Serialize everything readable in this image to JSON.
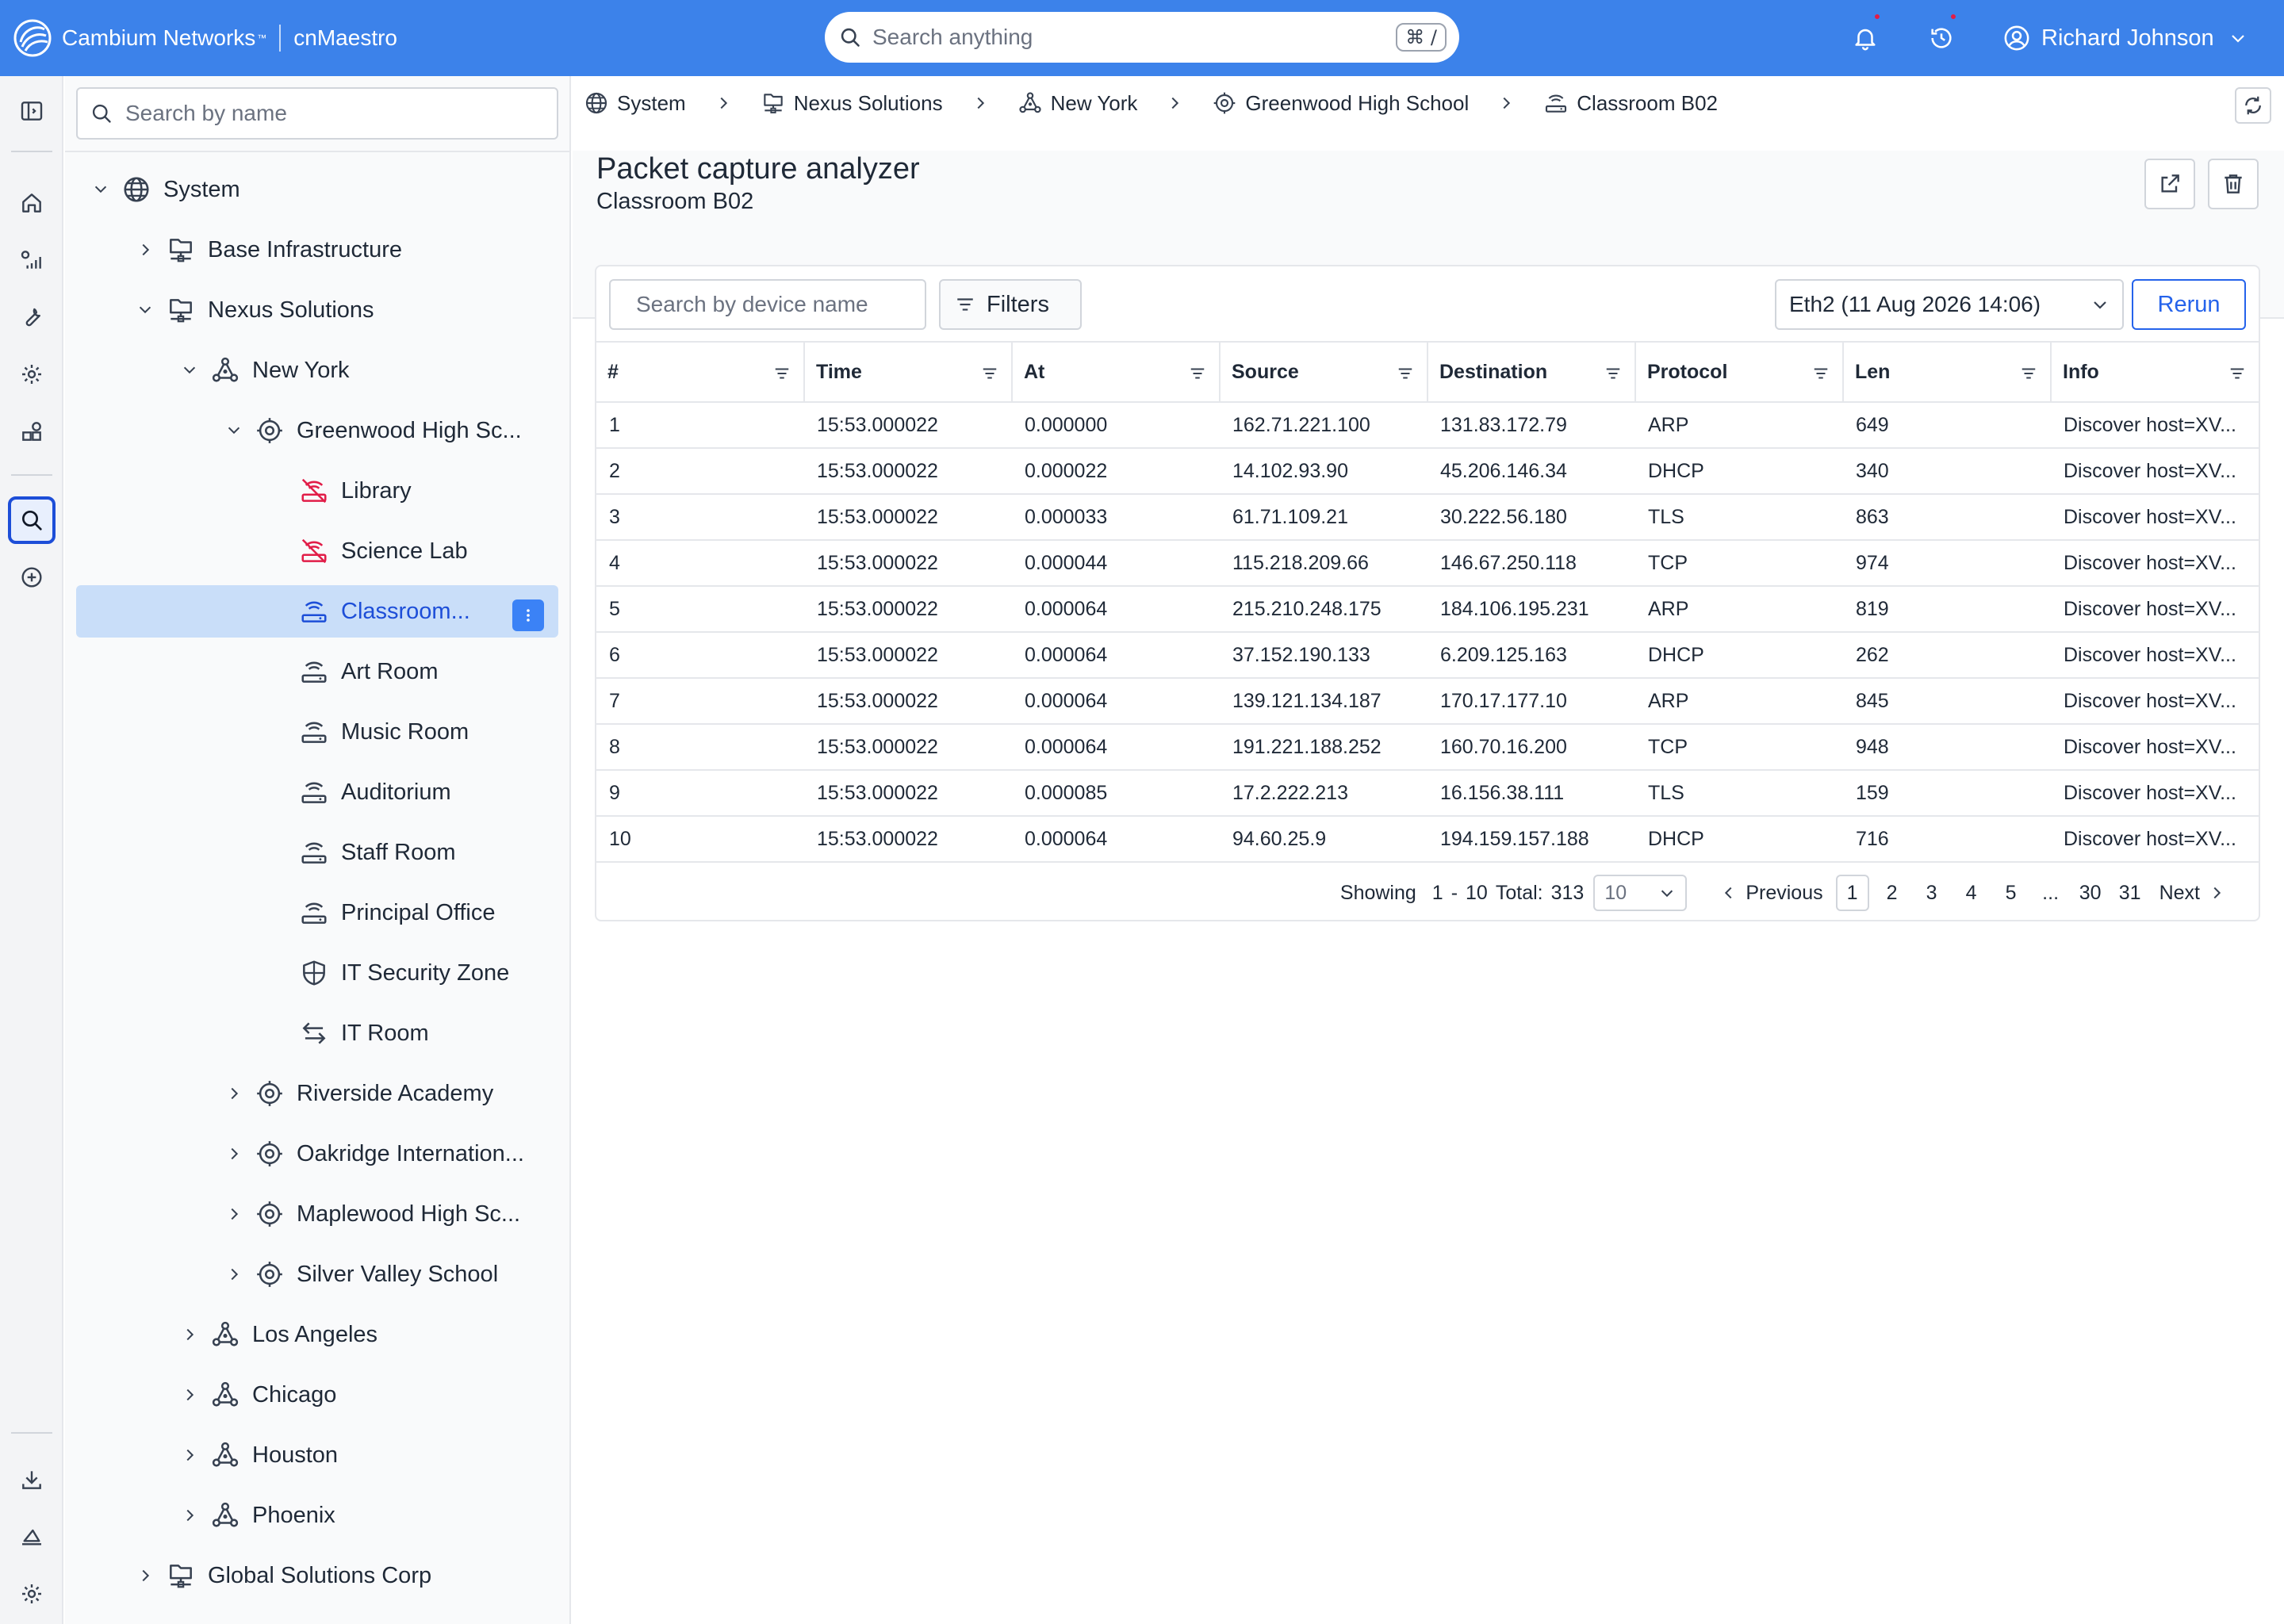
{
  "topbar": {
    "brand": "Cambium Networks",
    "brand_tm": "™",
    "product": "cnMaestro",
    "search_placeholder": "Search anything",
    "search_shortcut": "⌘ /",
    "user_name": "Richard Johnson"
  },
  "tree": {
    "search_placeholder": "Search by name",
    "nodes": [
      {
        "label": "System",
        "icon": "globe-icon",
        "expanded": true
      },
      {
        "label": "Base Infrastructure",
        "icon": "network-folder-icon",
        "expanded": false
      },
      {
        "label": "Nexus Solutions",
        "icon": "network-folder-icon",
        "expanded": true
      },
      {
        "label": "New York",
        "icon": "tower-icon",
        "expanded": true
      },
      {
        "label": "Greenwood High Sc...",
        "icon": "site-icon",
        "expanded": true
      },
      {
        "label": "Library",
        "icon": "ap-offline-icon"
      },
      {
        "label": "Science Lab",
        "icon": "ap-offline-icon"
      },
      {
        "label": "Classroom...",
        "icon": "ap-icon",
        "selected": true
      },
      {
        "label": "Art Room",
        "icon": "ap-icon"
      },
      {
        "label": "Music Room",
        "icon": "ap-icon"
      },
      {
        "label": "Auditorium",
        "icon": "ap-icon"
      },
      {
        "label": "Staff Room",
        "icon": "ap-icon"
      },
      {
        "label": "Principal Office",
        "icon": "ap-icon"
      },
      {
        "label": "IT Security Zone",
        "icon": "shield-icon"
      },
      {
        "label": "IT Room",
        "icon": "switch-icon"
      },
      {
        "label": "Riverside Academy",
        "icon": "site-icon",
        "expanded": false
      },
      {
        "label": "Oakridge Internation...",
        "icon": "site-icon",
        "expanded": false
      },
      {
        "label": "Maplewood High Sc...",
        "icon": "site-icon",
        "expanded": false
      },
      {
        "label": "Silver Valley School",
        "icon": "site-icon",
        "expanded": false
      },
      {
        "label": "Los Angeles",
        "icon": "tower-icon",
        "expanded": false
      },
      {
        "label": "Chicago",
        "icon": "tower-icon",
        "expanded": false
      },
      {
        "label": "Houston",
        "icon": "tower-icon",
        "expanded": false
      },
      {
        "label": "Phoenix",
        "icon": "tower-icon",
        "expanded": false
      },
      {
        "label": "Global Solutions Corp",
        "icon": "network-folder-icon",
        "expanded": false
      }
    ]
  },
  "breadcrumb": [
    {
      "label": "System",
      "icon": "globe-icon"
    },
    {
      "label": "Nexus Solutions",
      "icon": "network-folder-icon"
    },
    {
      "label": "New York",
      "icon": "tower-icon"
    },
    {
      "label": "Greenwood High School",
      "icon": "site-icon"
    },
    {
      "label": "Classroom B02",
      "icon": "ap-icon"
    }
  ],
  "page": {
    "title": "Packet capture analyzer",
    "subtitle": "Classroom B02"
  },
  "toolbar": {
    "device_search_placeholder": "Search by device name",
    "filters_label": "Filters",
    "interface_selected": "Eth2 (11 Aug 2026 14:06)",
    "rerun_label": "Rerun"
  },
  "table": {
    "columns": [
      "#",
      "Time",
      "At",
      "Source",
      "Destination",
      "Protocol",
      "Len",
      "Info"
    ],
    "rows": [
      [
        "1",
        "15:53.000022",
        "0.000000",
        "162.71.221.100",
        "131.83.172.79",
        "ARP",
        "649",
        "Discover host=XV..."
      ],
      [
        "2",
        "15:53.000022",
        "0.000022",
        "14.102.93.90",
        "45.206.146.34",
        "DHCP",
        "340",
        "Discover host=XV..."
      ],
      [
        "3",
        "15:53.000022",
        "0.000033",
        "61.71.109.21",
        "30.222.56.180",
        "TLS",
        "863",
        "Discover host=XV..."
      ],
      [
        "4",
        "15:53.000022",
        "0.000044",
        "115.218.209.66",
        "146.67.250.118",
        "TCP",
        "974",
        "Discover host=XV..."
      ],
      [
        "5",
        "15:53.000022",
        "0.000064",
        "215.210.248.175",
        "184.106.195.231",
        "ARP",
        "819",
        "Discover host=XV..."
      ],
      [
        "6",
        "15:53.000022",
        "0.000064",
        "37.152.190.133",
        "6.209.125.163",
        "DHCP",
        "262",
        "Discover host=XV..."
      ],
      [
        "7",
        "15:53.000022",
        "0.000064",
        "139.121.134.187",
        "170.17.177.10",
        "ARP",
        "845",
        "Discover host=XV..."
      ],
      [
        "8",
        "15:53.000022",
        "0.000064",
        "191.221.188.252",
        "160.70.16.200",
        "TCP",
        "948",
        "Discover host=XV..."
      ],
      [
        "9",
        "15:53.000022",
        "0.000085",
        "17.2.222.213",
        "16.156.38.111",
        "TLS",
        "159",
        "Discover host=XV..."
      ],
      [
        "10",
        "15:53.000022",
        "0.000064",
        "94.60.25.9",
        "194.159.157.188",
        "DHCP",
        "716",
        "Discover host=XV..."
      ]
    ]
  },
  "pagination": {
    "showing_label": "Showing",
    "range_start": "1",
    "range_sep": "-",
    "range_end": "10",
    "total_label": "Total:",
    "total": "313",
    "per_page": "10",
    "previous_label": "Previous",
    "next_label": "Next",
    "pages": [
      "1",
      "2",
      "3",
      "4",
      "5",
      "...",
      "30",
      "31"
    ],
    "current_page": "1"
  },
  "colors": {
    "brand_blue": "#3c82ea",
    "selected_bg": "#c9def9",
    "accent": "#2563eb",
    "offline_red": "#e11d48"
  }
}
